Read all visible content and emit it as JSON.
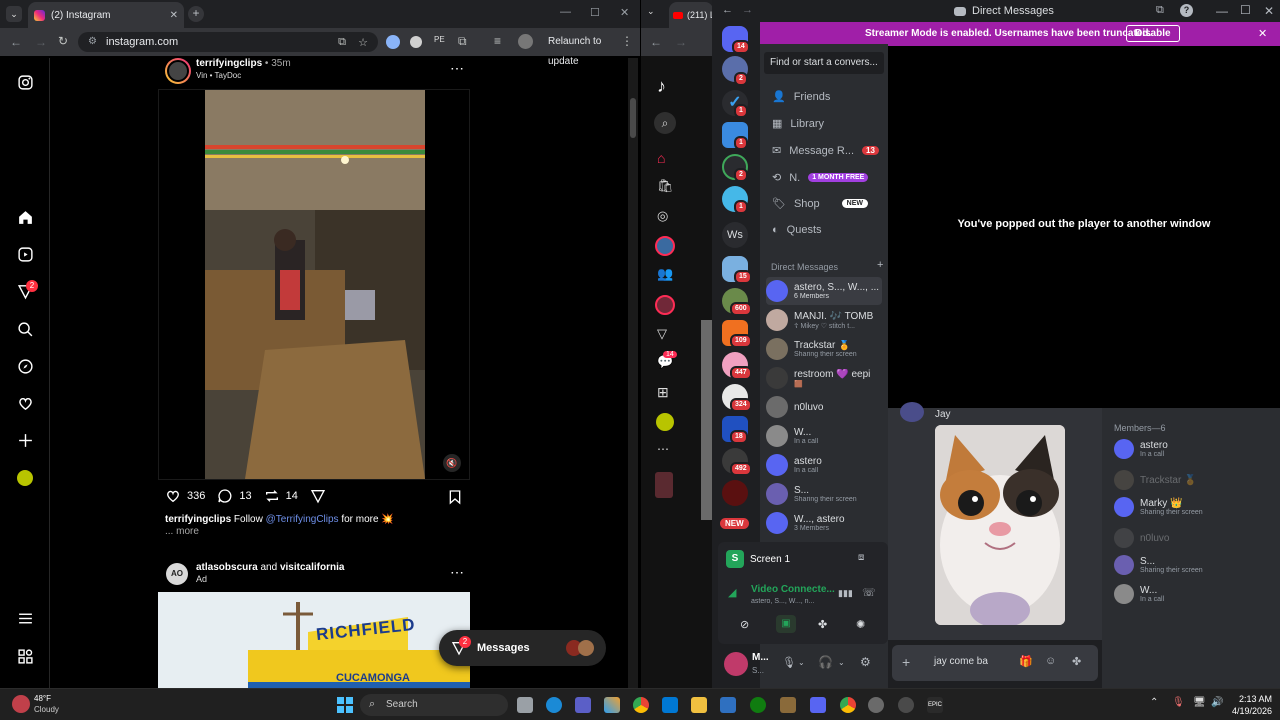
{
  "left_browser": {
    "tab_title": "(2) Instagram",
    "url": "instagram.com",
    "relaunch_label": "Relaunch to update",
    "notif_badge": "2"
  },
  "post1": {
    "author": "terrifyingclips",
    "time": "• 35m",
    "audio": "Vin • TayDoc",
    "likes": "336",
    "comments": "13",
    "reposts": "14",
    "caption_user": "terrifyingclips",
    "caption_follow": "Follow",
    "caption_link": "@TerrifyingClips",
    "caption_rest": "for more 💥",
    "more": "... more"
  },
  "post2": {
    "author": "atlasobscura",
    "and": "and",
    "coauthor": "visitcalifornia",
    "ad": "Ad",
    "sign1": "RICHFIELD",
    "sign2": "CUCAMONGA"
  },
  "messages_pill": {
    "label": "Messages",
    "badge": "2"
  },
  "right_browser": {
    "tab_title": "(211) L",
    "tiktok_badge": "14",
    "new_label": "NEW"
  },
  "discord": {
    "title": "Direct Messages",
    "banner_text": "Streamer Mode is enabled. Usernames have been truncated.",
    "banner_button": "Disable",
    "search_placeholder": "Find or start a convers...",
    "nav": {
      "friends": "Friends",
      "library": "Library",
      "message_requests": "Message R...",
      "message_requests_badge": "13",
      "nitro": "N.",
      "nitro_badge": "1 MONTH FREE",
      "shop": "Shop",
      "shop_badge": "NEW",
      "quests": "Quests"
    },
    "dm_header": "Direct Messages",
    "dms": [
      {
        "name": "astero, S..., W..., ...",
        "sub": "6 Members",
        "color": "#5865f2"
      },
      {
        "name": "MANJI. 🎶 TOMB",
        "sub": "☦ Mikey ♡ stitch t...",
        "color": "#c0a9a0"
      },
      {
        "name": "Trackstar 🏅",
        "sub": "Sharing their screen",
        "color": "#7a7060"
      },
      {
        "name": "restroom 💜 eepi",
        "sub": "🟫",
        "color": "#3a3a3a"
      },
      {
        "name": "n0luvo",
        "sub": "",
        "color": "#6b6b6b"
      },
      {
        "name": "W...",
        "sub": "In a call",
        "color": "#8a8a8a"
      },
      {
        "name": "astero",
        "sub": "In a call",
        "color": "#5865f2"
      },
      {
        "name": "S...",
        "sub": "Sharing their screen",
        "color": "#6a5fb0"
      },
      {
        "name": "W..., astero",
        "sub": "3 Members",
        "color": "#5865f2"
      }
    ],
    "server_badges": [
      "14",
      "2",
      "1",
      "1",
      "2",
      "1",
      "15",
      "600",
      "109",
      "447",
      "324",
      "18",
      "492"
    ],
    "server_ws": "Ws",
    "screen_label": "Screen 1",
    "voice_status": "Video Connecte...",
    "voice_sub": "astero, S..., W..., n...",
    "user_name": "M...",
    "user_sub": "S...",
    "popout_text": "You've popped out the player to another window",
    "chat_author": "Jay",
    "chat_input": "jay come ba",
    "members_header": "Members—6",
    "members": [
      {
        "name": "astero",
        "sub": "In a call",
        "dim": false,
        "color": "#5865f2"
      },
      {
        "name": "Trackstar 🏅",
        "sub": "",
        "dim": true,
        "color": "#7a7060"
      },
      {
        "name": "Marky 👑",
        "sub": "Sharing their screen",
        "dim": false,
        "color": "#5865f2"
      },
      {
        "name": "n0luvo",
        "sub": "",
        "dim": true,
        "color": "#6b6b6b"
      },
      {
        "name": "S...",
        "sub": "Sharing their screen",
        "dim": false,
        "color": "#6a5fb0"
      },
      {
        "name": "W...",
        "sub": "In a call",
        "dim": false,
        "color": "#8a8a8a"
      }
    ]
  },
  "taskbar": {
    "weather_temp": "48°F",
    "weather_desc": "Cloudy",
    "search_label": "Search",
    "time": "2:13 AM",
    "date": "4/19/2026"
  }
}
